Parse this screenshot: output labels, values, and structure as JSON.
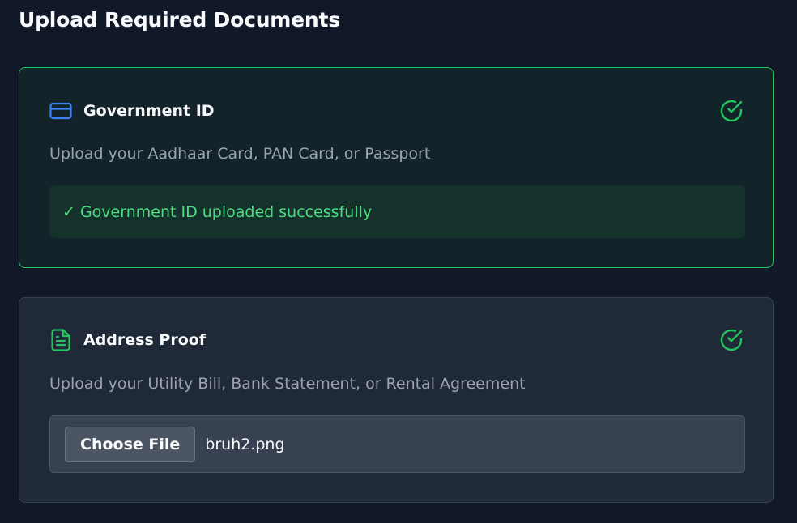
{
  "page": {
    "title": "Upload Required Documents"
  },
  "documents": [
    {
      "title": "Government ID",
      "icon": "credit-card-icon",
      "description": "Upload your Aadhaar Card, PAN Card, or Passport",
      "status_icon": "check-circle-icon",
      "success_message": "✓ Government ID uploaded successfully"
    },
    {
      "title": "Address Proof",
      "icon": "file-text-icon",
      "description": "Upload your Utility Bill, Bank Statement, or Rental Agreement",
      "status_icon": "check-circle-icon",
      "file_input": {
        "button_label": "Choose File",
        "file_name": "bruh2.png"
      }
    }
  ],
  "colors": {
    "background": "#111827",
    "success": "#22c55e",
    "success_text": "#4ade80",
    "accent_blue": "#3b82f6",
    "muted_text": "#9ca3af"
  }
}
